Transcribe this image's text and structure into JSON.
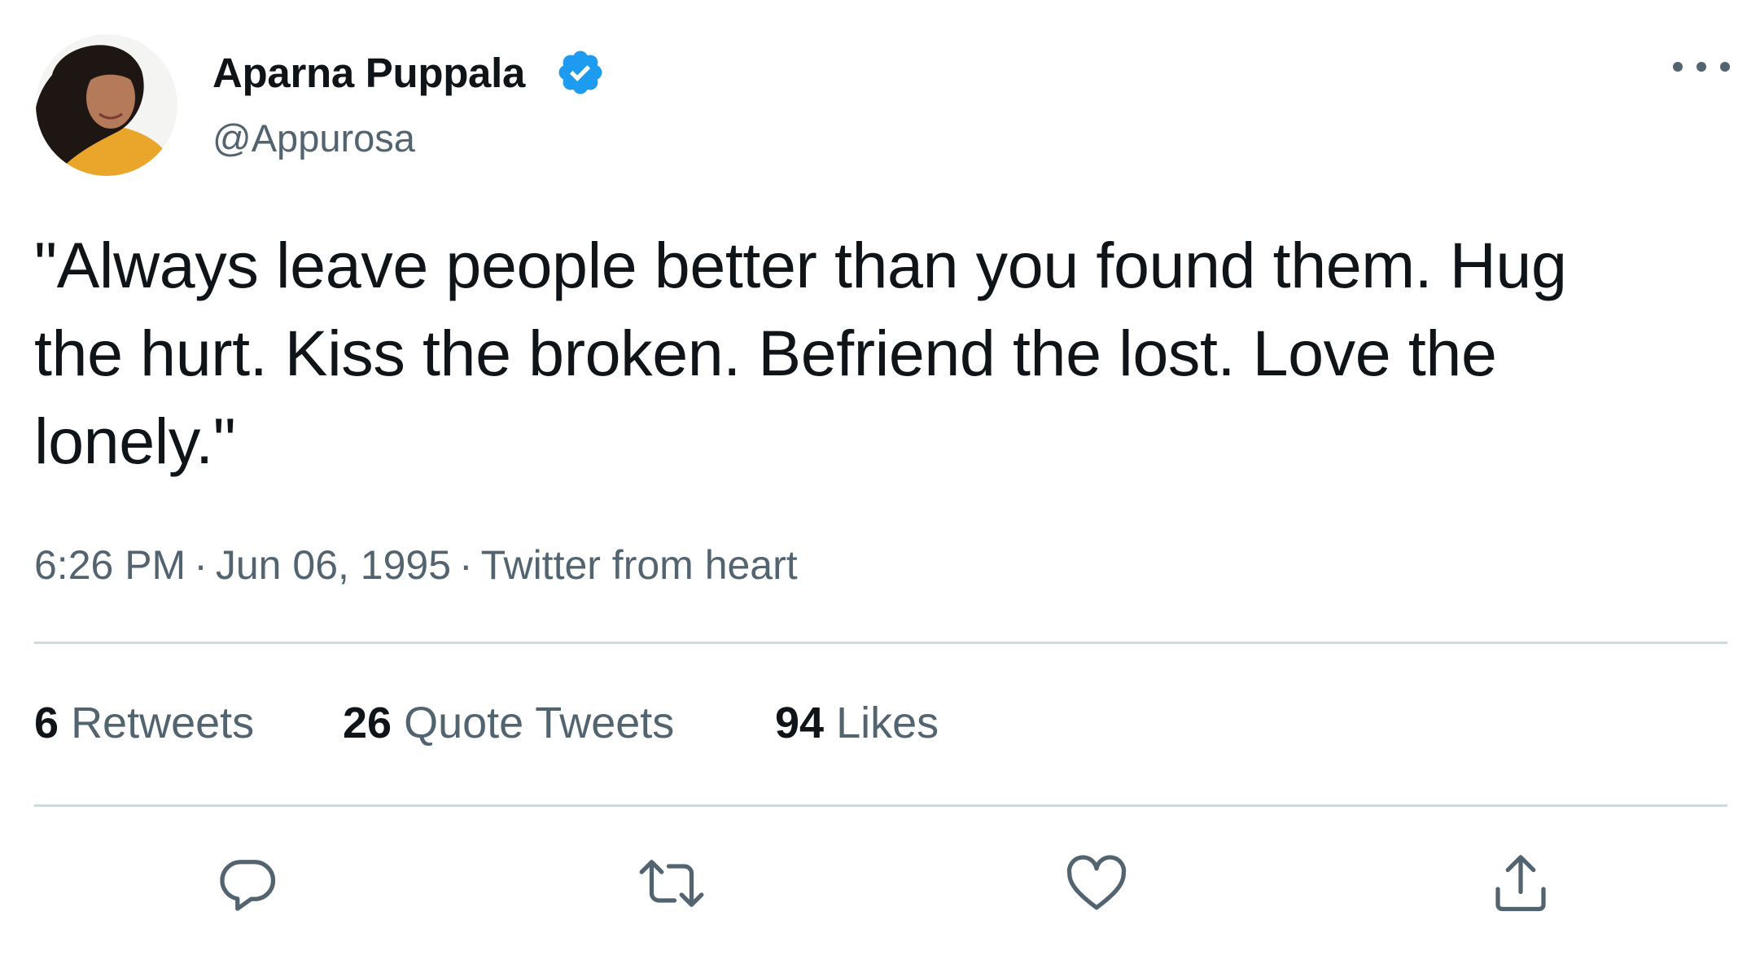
{
  "author": {
    "display_name": "Aparna Puppala",
    "handle": "@Appurosa",
    "verified": true
  },
  "tweet": {
    "text_lines": [
      "\"Always leave people better than you found them. Hug",
      "the hurt. Kiss the broken. Befriend the lost. Love the",
      "lonely.\""
    ],
    "time": "6:26 PM",
    "date": "Jun 06, 1995",
    "source": "Twitter from heart",
    "separator": "·"
  },
  "stats": {
    "retweets": {
      "count": "6",
      "label": "Retweets"
    },
    "quote_tweets": {
      "count": "26",
      "label": "Quote Tweets"
    },
    "likes": {
      "count": "94",
      "label": "Likes"
    }
  },
  "actions": [
    "reply-icon",
    "retweet-icon",
    "like-icon",
    "share-icon"
  ],
  "colors": {
    "text_primary": "#0f1419",
    "text_secondary": "#536471",
    "divider": "#cfd9de",
    "verified_blue": "#1d9bf0"
  }
}
